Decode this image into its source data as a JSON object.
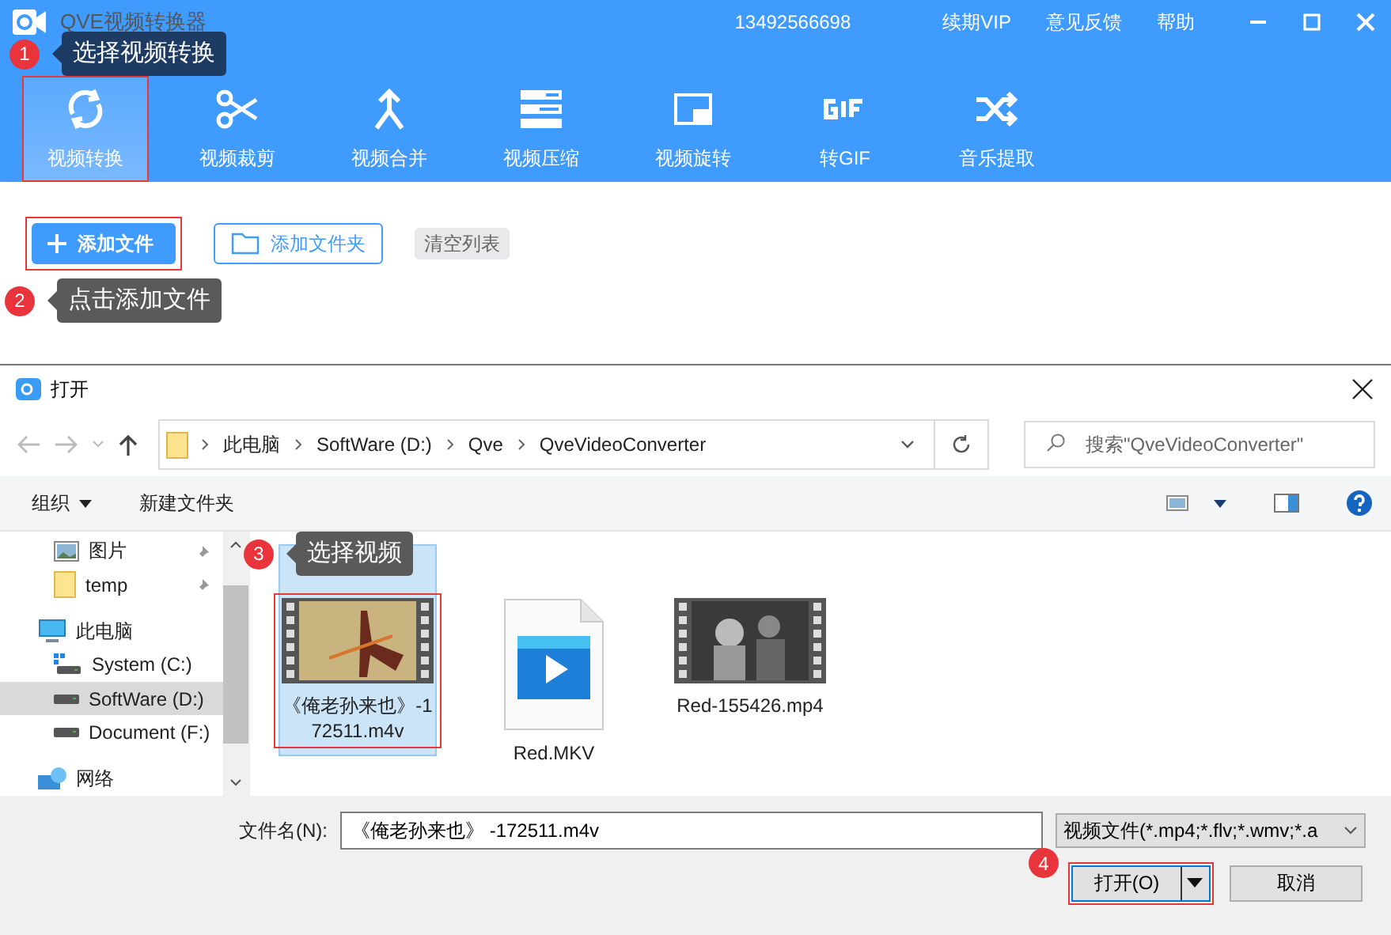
{
  "app": {
    "title": "QVE视频转换器",
    "phone": "13492566698",
    "links": [
      "续期VIP",
      "意见反馈",
      "帮助"
    ]
  },
  "tools": [
    {
      "label": "视频转换",
      "selected": true,
      "highlighted": true
    },
    {
      "label": "视频裁剪",
      "selected": false,
      "highlighted": false
    },
    {
      "label": "视频合并",
      "selected": false,
      "highlighted": false
    },
    {
      "label": "视频压缩",
      "selected": false,
      "highlighted": false
    },
    {
      "label": "视频旋转",
      "selected": false,
      "highlighted": false
    },
    {
      "label": "转GIF",
      "selected": false,
      "highlighted": false
    },
    {
      "label": "音乐提取",
      "selected": false,
      "highlighted": false
    }
  ],
  "actions": [
    {
      "kind": "primary",
      "label": "添加文件",
      "highlighted": true
    },
    {
      "kind": "outline",
      "label": "添加文件夹",
      "highlighted": false
    },
    {
      "kind": "plain",
      "label": "清空列表",
      "highlighted": false
    }
  ],
  "callouts": [
    {
      "number": "1",
      "text": "选择视频转换"
    },
    {
      "number": "2",
      "text": "点击添加文件"
    },
    {
      "number": "3",
      "text": "选择视频"
    },
    {
      "number": "4"
    }
  ],
  "dialog": {
    "title": "打开",
    "breadcrumb": [
      "此电脑",
      "SoftWare (D:)",
      "Qve",
      "QveVideoConverter"
    ],
    "search": {
      "placeholder": "搜索\"QveVideoConverter\""
    },
    "commands": [
      "组织",
      "新建文件夹"
    ],
    "nav": [
      {
        "label": "图片",
        "pinned": true,
        "selected": false
      },
      {
        "label": "temp",
        "pinned": true,
        "selected": false
      },
      {
        "label": "此电脑",
        "pinned": false,
        "selected": false
      },
      {
        "label": "System (C:)",
        "pinned": false,
        "selected": false
      },
      {
        "label": "SoftWare (D:)",
        "pinned": false,
        "selected": true
      },
      {
        "label": "Document (F:)",
        "pinned": false,
        "selected": false
      },
      {
        "label": "网络",
        "pinned": false,
        "selected": false
      }
    ],
    "files": [
      {
        "name": "《俺老孙来也》-172511.m4v",
        "kind": "video",
        "selected": true,
        "highlighted": true
      },
      {
        "name": "Red.MKV",
        "kind": "document",
        "selected": false,
        "highlighted": false
      },
      {
        "name": "Red-155426.mp4",
        "kind": "video",
        "selected": false,
        "highlighted": false
      }
    ],
    "filename": {
      "label": "文件名(N):",
      "value": "《俺老孙来也》 -172511.m4v"
    },
    "filter": "视频文件(*.mp4;*.flv;*.wmv;*.a",
    "buttons": [
      {
        "label": "打开(O)",
        "kind": "split",
        "highlighted": true
      },
      {
        "label": "取消",
        "kind": "plain",
        "highlighted": false
      }
    ]
  }
}
